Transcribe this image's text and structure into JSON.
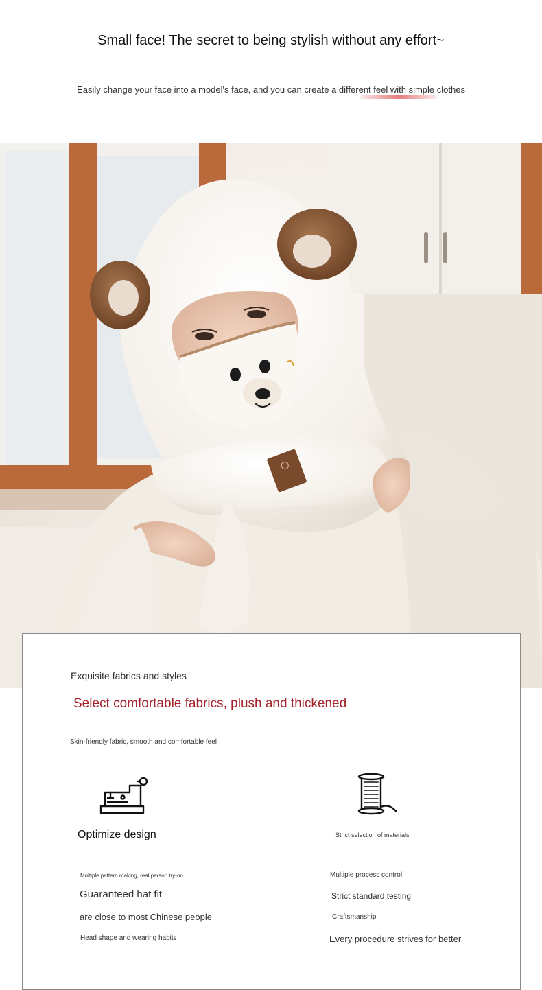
{
  "header": {
    "headline": "Small face! The secret to being stylish without any effort~",
    "subline": "Easily change your face into a model's face, and you can create a different feel with simple clothes"
  },
  "photo": {
    "description_icon": "product-photo",
    "palette": {
      "background": "#efe9e2",
      "window_frame": "#b9693a",
      "fur": "#f6f2ec",
      "ear": "#8a5a38",
      "label": "#7a4a2c"
    }
  },
  "card": {
    "eyebrow": "Exquisite fabrics and styles",
    "title": "Select comfortable fabrics, plush and thickened",
    "description": "Skin-friendly fabric, smooth and comfortable feel",
    "title_color": "#a3232a",
    "features": [
      {
        "icon": "sewing-machine-icon",
        "title": "Optimize design",
        "note_top": "Multiple pattern making, real person try-on",
        "line_big": "Guaranteed hat fit",
        "line_mid": "are close to most Chinese people",
        "note_bottom": "Head shape and wearing habits"
      },
      {
        "icon": "thread-spool-icon",
        "title": "Strict selection of materials",
        "note_top": "Multiple process control",
        "line_big": "Strict standard testing",
        "line_mid": "Craftsmanship",
        "note_bottom": "Every procedure strives for better"
      }
    ]
  }
}
